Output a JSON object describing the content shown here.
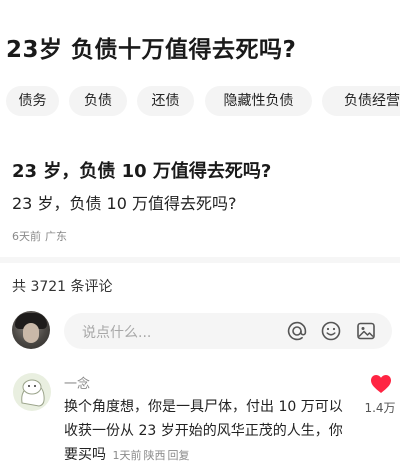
{
  "post": {
    "title": "23岁 负债十万值得去死吗?"
  },
  "tags": [
    {
      "label": "债务"
    },
    {
      "label": "负债"
    },
    {
      "label": "还债"
    },
    {
      "label": "隐藏性负债"
    },
    {
      "label": "负债经营"
    }
  ],
  "question": {
    "title": "23 岁，负债 10 万值得去死吗?",
    "body": "23 岁，负债 10 万值得去死吗?",
    "time": "6天前",
    "location": "广东"
  },
  "comments_section": {
    "count_label": "共 3721 条评论",
    "input_placeholder": "说点什么...",
    "icons": [
      "at-icon",
      "emoji-icon",
      "image-icon"
    ]
  },
  "comment": {
    "username": "一念",
    "text": "换个角度想，你是一具尸体，付出 10 万可以收获一份从 23 岁开始的风华正茂的人生，你要买吗",
    "time": "1天前",
    "location": "陕西",
    "reply_label": "回复",
    "likes": "1.4万",
    "like_icon": "heart-icon",
    "like_color": "#ff2442"
  },
  "colors": {
    "chip_bg": "#f4f4f4",
    "input_bg": "#f5f5f5",
    "meta_text": "#8a8a8a"
  }
}
